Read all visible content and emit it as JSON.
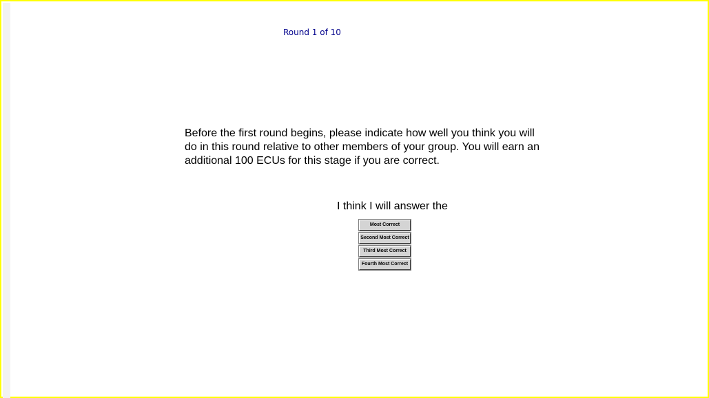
{
  "header": {
    "round_label": "Round 1 of 10"
  },
  "main": {
    "instructions": "Before the first round begins, please indicate how well you think you will do in this round relative to other members of your group. You will earn an additional 100 ECUs for this stage if you are correct.",
    "prompt": "I think I will answer the",
    "options": [
      {
        "label": "Most Correct"
      },
      {
        "label": "Second Most Correct"
      },
      {
        "label": "Third Most Correct"
      },
      {
        "label": "Fourth Most Correct"
      }
    ]
  },
  "colors": {
    "frame_border": "#ffff00",
    "round_label": "#00008b",
    "button_face": "#d4d4d4"
  }
}
